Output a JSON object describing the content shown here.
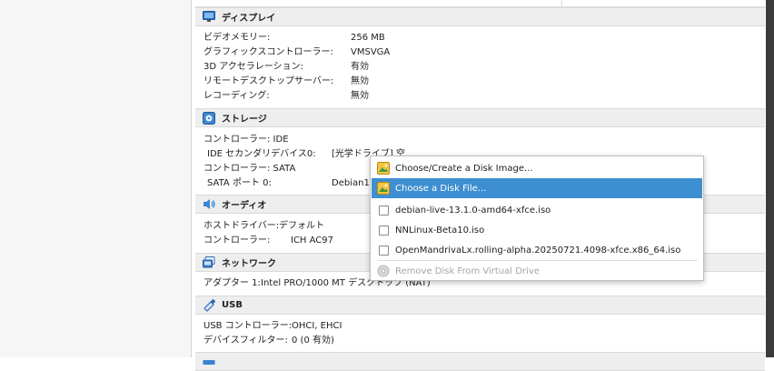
{
  "display": {
    "title": "ディスプレイ",
    "rows": [
      {
        "label": "ビデオメモリー:",
        "value": "256 MB"
      },
      {
        "label": "グラフィックスコントローラー:",
        "value": "VMSVGA"
      },
      {
        "label": "3D アクセラレーション:",
        "value": "有効"
      },
      {
        "label": "リモートデスクトップサーバー:",
        "value": "無効"
      },
      {
        "label": "レコーディング:",
        "value": "無効"
      }
    ]
  },
  "storage": {
    "title": "ストレージ",
    "rows": [
      {
        "label": "コントローラー: IDE",
        "value": ""
      },
      {
        "label": "IDE セカンダリデバイス0:",
        "value": "[光学ドライブ] 空"
      },
      {
        "label": "コントローラー: SATA",
        "value": ""
      },
      {
        "label": "SATA ポート 0:",
        "value": "Debian1"
      }
    ]
  },
  "audio": {
    "title": "オーディオ",
    "rows": [
      {
        "label": "ホストドライバー:",
        "value": "デフォルト"
      },
      {
        "label": "コントローラー:",
        "value": "ICH AC97"
      }
    ]
  },
  "network": {
    "title": "ネットワーク",
    "rows": [
      {
        "label": "アダプター 1:",
        "value": "Intel PRO/1000 MT デスクトップ (NAT)"
      }
    ]
  },
  "usb": {
    "title": "USB",
    "rows": [
      {
        "label": "USB コントローラー:",
        "value": "OHCI, EHCI"
      },
      {
        "label": "デバイスフィルター:",
        "value": "0 (0 有効)"
      }
    ]
  },
  "menu": {
    "items": [
      {
        "label": "Choose/Create a Disk Image...",
        "icon": "disk-image-icon"
      },
      {
        "label": "Choose a Disk File...",
        "icon": "disk-image-icon",
        "selected": true
      },
      {
        "label": "debian-live-13.1.0-amd64-xfce.iso",
        "icon": "checkbox-icon"
      },
      {
        "label": "NNLinux-Beta10.iso",
        "icon": "checkbox-icon"
      },
      {
        "label": "OpenMandrivaLx.rolling-alpha.20250721.4098-xfce.x86_64.iso",
        "icon": "checkbox-icon"
      },
      {
        "label": "Remove Disk From Virtual Drive",
        "icon": "remove-disc-icon",
        "disabled": true
      }
    ]
  },
  "colors": {
    "selection": "#3d8fd1",
    "section_header": "#eeeeee"
  }
}
